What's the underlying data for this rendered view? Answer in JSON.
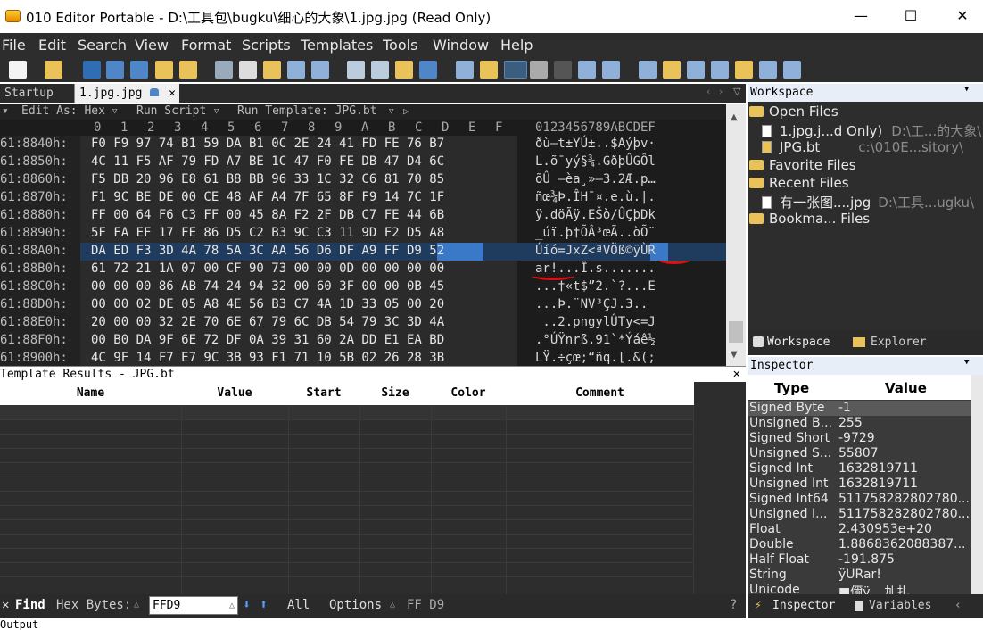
{
  "window": {
    "title": "010 Editor Portable - D:\\工具包\\bugku\\细心的大象\\1.jpg.jpg (Read Only)",
    "minimize": "—",
    "maximize": "☐",
    "close": "✕"
  },
  "menu": [
    "File",
    "Edit",
    "Search",
    "View",
    "Format",
    "Scripts",
    "Templates",
    "Tools",
    "Window",
    "Help"
  ],
  "tabs": {
    "startup": "Startup",
    "file": "1.jpg.jpg",
    "close": "✕"
  },
  "editor_header": {
    "edit_as": "Edit As: Hex",
    "run_script": "Run Script",
    "run_template": "Run Template: JPG.bt"
  },
  "hex": {
    "column_digits": [
      "0",
      "1",
      "2",
      "3",
      "4",
      "5",
      "6",
      "7",
      "8",
      "9",
      "A",
      "B",
      "C",
      "D",
      "E",
      "F"
    ],
    "ascii_header": "0123456789ABCDEF",
    "rows": [
      {
        "addr": "61:8840h:",
        "hex": "F0 F9 97 74 B1 59 DA B1 0C 2E 24 41 FD FE 76 B7",
        "ascii": "ðù—t±YÚ±..$Aýþv·"
      },
      {
        "addr": "61:8850h:",
        "hex": "4C 11 F5 AF 79 FD A7 BE 1C 47 F0 FE DB 47 D4 6C",
        "ascii": "L.õ¯yý§¾.GðþÛGÔl"
      },
      {
        "addr": "61:8860h:",
        "hex": "F5 DB 20 96 E8 61 B8 BB 96 33 1C 32 C6 81 70 85",
        "ascii": "õÛ –èa¸»–3.2Æ.p…"
      },
      {
        "addr": "61:8870h:",
        "hex": "F1 9C BE DE 00 CE 48 AF A4 7F 65 8F F9 14 7C 1F",
        "ascii": "ñœ¾Þ.ÎH¯¤.e.ù.|."
      },
      {
        "addr": "61:8880h:",
        "hex": "FF 00 64 F6 C3 FF 00 45 8A F2 2F DB C7 FE 44 6B",
        "ascii": "ÿ.döÃÿ.EŠò/ÛÇþDk"
      },
      {
        "addr": "61:8890h:",
        "hex": "5F FA EF 17 FE 86 D5 C2 B3 9C C3 11 9D F2 D5 A8",
        "ascii": "_úï.þ†ÕÂ³œÃ..òÕ¨"
      },
      {
        "addr": "61:88A0h:",
        "hex": "DA ED F3 3D 4A 78 5A 3C AA 56 D6 DF A9 FF D9 52",
        "ascii": "Úíó=JxZ<ªVÖß©ÿÙR"
      },
      {
        "addr": "61:88B0h:",
        "hex": "61 72 21 1A 07 00 CF 90 73 00 00 0D 00 00 00 00",
        "ascii": "ar!...Ï.s......."
      },
      {
        "addr": "61:88C0h:",
        "hex": "00 00 00 86 AB 74 24 94 32 00 60 3F 00 00 0B 45",
        "ascii": "...†«t$”2.`?...E"
      },
      {
        "addr": "61:88D0h:",
        "hex": "00 00 02 DE 05 A8 4E 56 B3 C7 4A 1D 33 05 00 20",
        "ascii": "...Þ.¨NV³ÇJ.3.. "
      },
      {
        "addr": "61:88E0h:",
        "hex": "20 00 00 32 2E 70 6E 67 79 6C DB 54 79 3C 3D 4A",
        "ascii": " ..2.pngylÛTy<=J"
      },
      {
        "addr": "61:88F0h:",
        "hex": "00 B0 DA 9F 6E 72 DF 0A 39 31 60 2A DD E1 EA BD",
        "ascii": ".°ÚŸnrß.91`*Ýáê½"
      },
      {
        "addr": "61:8900h:",
        "hex": "4C 9F 14 F7 E7 9C 3B 93 F1 71 10 5B 02 26 28 3B",
        "ascii": "LŸ.÷çœ;“ñq.[.&(;"
      }
    ]
  },
  "template_results": {
    "title": "Template Results - JPG.bt",
    "close": "✕",
    "columns": [
      "Name",
      "Value",
      "Start",
      "Size",
      "Color",
      "Comment"
    ]
  },
  "find": {
    "close": "✕",
    "label": "Find",
    "type": "Hex Bytes:",
    "value": "FFD9",
    "all": "All",
    "options": "Options",
    "result": "FF D9",
    "help": "?"
  },
  "output": {
    "title": "Output"
  },
  "workspace": {
    "title": "Workspace",
    "items": [
      {
        "label": "Open Files",
        "path": ""
      },
      {
        "label": "1.jpg.j...d Only)",
        "path": "D:\\工...的大象\\"
      },
      {
        "label": "JPG.bt",
        "path": "c:\\010E...sitory\\"
      },
      {
        "label": "Favorite Files",
        "path": ""
      },
      {
        "label": "Recent Files",
        "path": ""
      },
      {
        "label": "有一张图....jpg",
        "path": "D:\\工具...ugku\\"
      },
      {
        "label": "Bookma... Files",
        "path": ""
      }
    ],
    "tab_workspace": "Workspace",
    "tab_explorer": "Explorer"
  },
  "inspector": {
    "title": "Inspector",
    "col_type": "Type",
    "col_value": "Value",
    "rows": [
      {
        "type": "Signed Byte",
        "value": "-1"
      },
      {
        "type": "Unsigned B...",
        "value": "255"
      },
      {
        "type": "Signed Short",
        "value": "-9729"
      },
      {
        "type": "Unsigned S...",
        "value": "55807"
      },
      {
        "type": "Signed Int",
        "value": "1632819711"
      },
      {
        "type": "Unsigned Int",
        "value": "1632819711"
      },
      {
        "type": "Signed Int64",
        "value": "511758282802780..."
      },
      {
        "type": "Unsigned I...",
        "value": "511758282802780..."
      },
      {
        "type": "Float",
        "value": "2.430953e+20"
      },
      {
        "type": "Double",
        "value": "1.8868362088387..."
      },
      {
        "type": "Half Float",
        "value": "-191.875"
      },
      {
        "type": "String",
        "value": "ÿÙRar!"
      },
      {
        "type": "Unicode",
        "value": "■儞ÿ... 劜扎"
      }
    ],
    "tab_inspector": "Inspector",
    "tab_variables": "Variables"
  }
}
